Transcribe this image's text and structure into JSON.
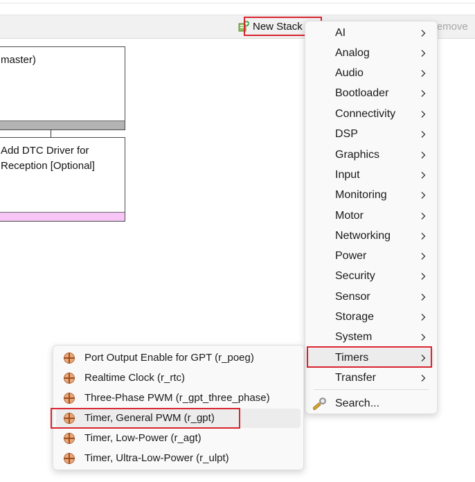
{
  "toolbar": {
    "new_stack_label": "New Stack",
    "remove_label": "Remove"
  },
  "canvas": {
    "modules": [
      {
        "text": "master)",
        "bar_color": "#b3b3b3"
      },
      {
        "text": "Add DTC Driver for\nReception [Optional]",
        "bar_color": "#f7c6f7"
      }
    ]
  },
  "menu": {
    "items": [
      {
        "label": "AI"
      },
      {
        "label": "Analog"
      },
      {
        "label": "Audio"
      },
      {
        "label": "Bootloader"
      },
      {
        "label": "Connectivity"
      },
      {
        "label": "DSP"
      },
      {
        "label": "Graphics"
      },
      {
        "label": "Input"
      },
      {
        "label": "Monitoring"
      },
      {
        "label": "Motor"
      },
      {
        "label": "Networking"
      },
      {
        "label": "Power"
      },
      {
        "label": "Security"
      },
      {
        "label": "Sensor"
      },
      {
        "label": "Storage"
      },
      {
        "label": "System"
      },
      {
        "label": "Timers"
      },
      {
        "label": "Transfer"
      }
    ],
    "search_label": "Search...",
    "selected": "Timers"
  },
  "submenu": {
    "items": [
      {
        "label": "Port Output Enable for GPT (r_poeg)"
      },
      {
        "label": "Realtime Clock (r_rtc)"
      },
      {
        "label": "Three-Phase PWM (r_gpt_three_phase)"
      },
      {
        "label": "Timer, General PWM (r_gpt)"
      },
      {
        "label": "Timer, Low-Power (r_agt)"
      },
      {
        "label": "Timer, Ultra-Low-Power (r_ulpt)"
      }
    ],
    "selected": "Timer, General PWM (r_gpt)"
  },
  "colors": {
    "highlight_box": "#d9232e",
    "menu_background": "#f9f9f9",
    "hover_background": "#ececec"
  },
  "icons": {
    "new_stack": "add-stack-icon",
    "remove": "remove-icon",
    "submenu_arrow": "chevron-right-icon",
    "search": "search-icon",
    "component": "component-icon"
  }
}
